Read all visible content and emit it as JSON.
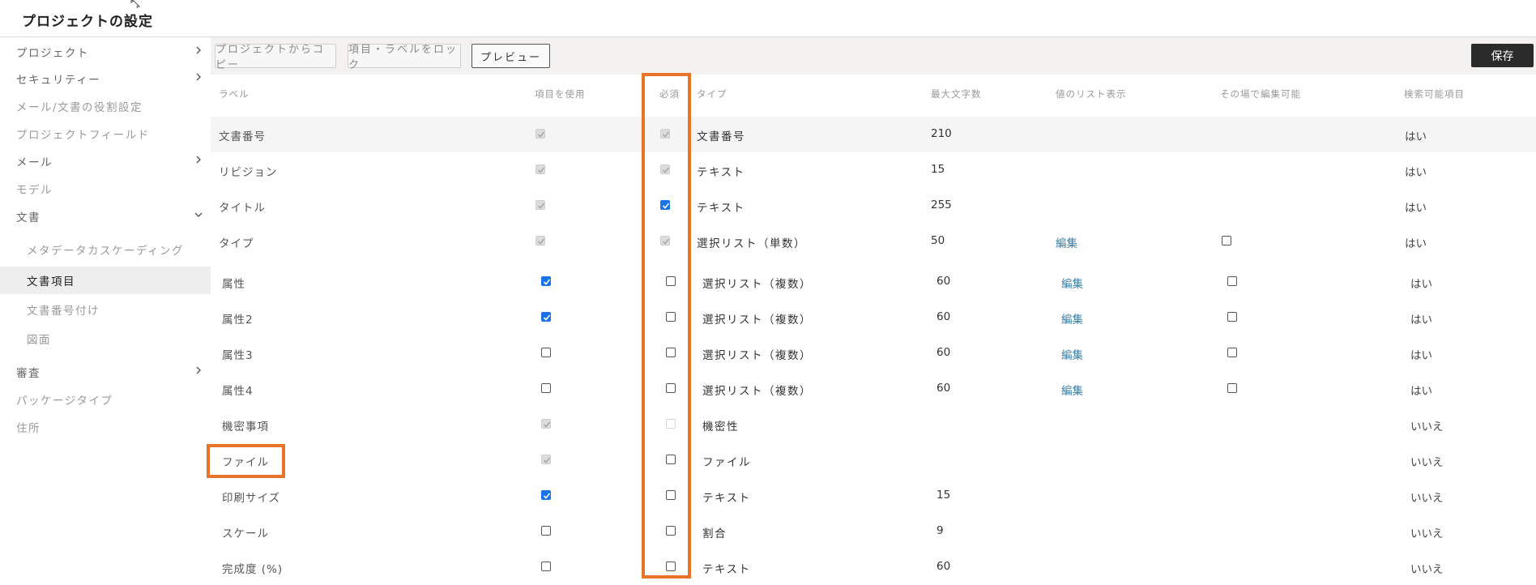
{
  "page_title": "プロジェクトの設定",
  "sidebar": {
    "items": [
      {
        "label": "プロジェクト",
        "chevron": "right"
      },
      {
        "label": "セキュリティー",
        "chevron": "right"
      },
      {
        "label": "メール/文書の役割設定"
      },
      {
        "label": "プロジェクトフィールド"
      },
      {
        "label": "メール",
        "chevron": "right"
      },
      {
        "label": "モデル"
      },
      {
        "label": "文書",
        "chevron": "down"
      },
      {
        "label": "メタデータカスケーディング"
      },
      {
        "label": "文書項目",
        "active": true
      },
      {
        "label": "文書番号付け"
      },
      {
        "label": "図面"
      },
      {
        "label": "審査",
        "chevron": "right"
      },
      {
        "label": "パッケージタイプ"
      },
      {
        "label": "住所"
      }
    ]
  },
  "toolbar": {
    "copy_label": "プロジェクトからコピー",
    "lock_label": "項目・ラベルをロック",
    "preview_label": "プレビュー",
    "save_label": "保存"
  },
  "table": {
    "headers": {
      "label": "ラベル",
      "use": "項目を使用",
      "required": "必須",
      "type": "タイプ",
      "max_chars": "最大文字数",
      "list_display": "値のリスト表示",
      "inline_edit": "その場で編集可能",
      "searchable": "検索可能項目"
    },
    "rows": [
      {
        "label": "文書番号",
        "use": "disabled-on",
        "required": "disabled-on",
        "type": "文書番号",
        "max": "210",
        "edit": "",
        "inline": "",
        "search": "はい"
      },
      {
        "label": "リビジョン",
        "use": "disabled-on",
        "required": "disabled-on",
        "type": "テキスト",
        "max": "15",
        "edit": "",
        "inline": "",
        "search": "はい"
      },
      {
        "label": "タイトル",
        "use": "disabled-on",
        "required": "on",
        "type": "テキスト",
        "max": "255",
        "edit": "",
        "inline": "",
        "search": "はい"
      },
      {
        "label": "タイプ",
        "use": "disabled-on",
        "required": "disabled-on",
        "type": "選択リスト（単数）",
        "max": "50",
        "edit": "編集",
        "inline": "off",
        "search": "はい"
      },
      {
        "label": "属性",
        "use": "on",
        "required": "off",
        "type": "選択リスト（複数）",
        "max": "60",
        "edit": "編集",
        "inline": "off",
        "search": "はい"
      },
      {
        "label": "属性2",
        "use": "on",
        "required": "off",
        "type": "選択リスト（複数）",
        "max": "60",
        "edit": "編集",
        "inline": "off",
        "search": "はい"
      },
      {
        "label": "属性3",
        "use": "off",
        "required": "off",
        "type": "選択リスト（複数）",
        "max": "60",
        "edit": "編集",
        "inline": "off",
        "search": "はい"
      },
      {
        "label": "属性4",
        "use": "off",
        "required": "off",
        "type": "選択リスト（複数）",
        "max": "60",
        "edit": "編集",
        "inline": "off",
        "search": "はい"
      },
      {
        "label": "機密事項",
        "use": "disabled-on",
        "required": "disabled-off",
        "type": "機密性",
        "max": "",
        "edit": "",
        "inline": "",
        "search": "いいえ"
      },
      {
        "label": "ファイル",
        "use": "disabled-on",
        "required": "off",
        "type": "ファイル",
        "max": "",
        "edit": "",
        "inline": "",
        "search": "いいえ"
      },
      {
        "label": "印刷サイズ",
        "use": "on",
        "required": "off",
        "type": "テキスト",
        "max": "15",
        "edit": "",
        "inline": "",
        "search": "いいえ"
      },
      {
        "label": "スケール",
        "use": "off",
        "required": "off",
        "type": "割合",
        "max": "9",
        "edit": "",
        "inline": "",
        "search": "いいえ"
      },
      {
        "label": "完成度 (%)",
        "use": "off",
        "required": "off",
        "type": "テキスト",
        "max": "60",
        "edit": "",
        "inline": "",
        "search": "いいえ"
      }
    ]
  },
  "colors": {
    "highlight": "#e8742a",
    "checkbox_checked": "#1a73e8",
    "edit_link": "#3a7ea6",
    "save_bg": "#2b2b2b"
  }
}
